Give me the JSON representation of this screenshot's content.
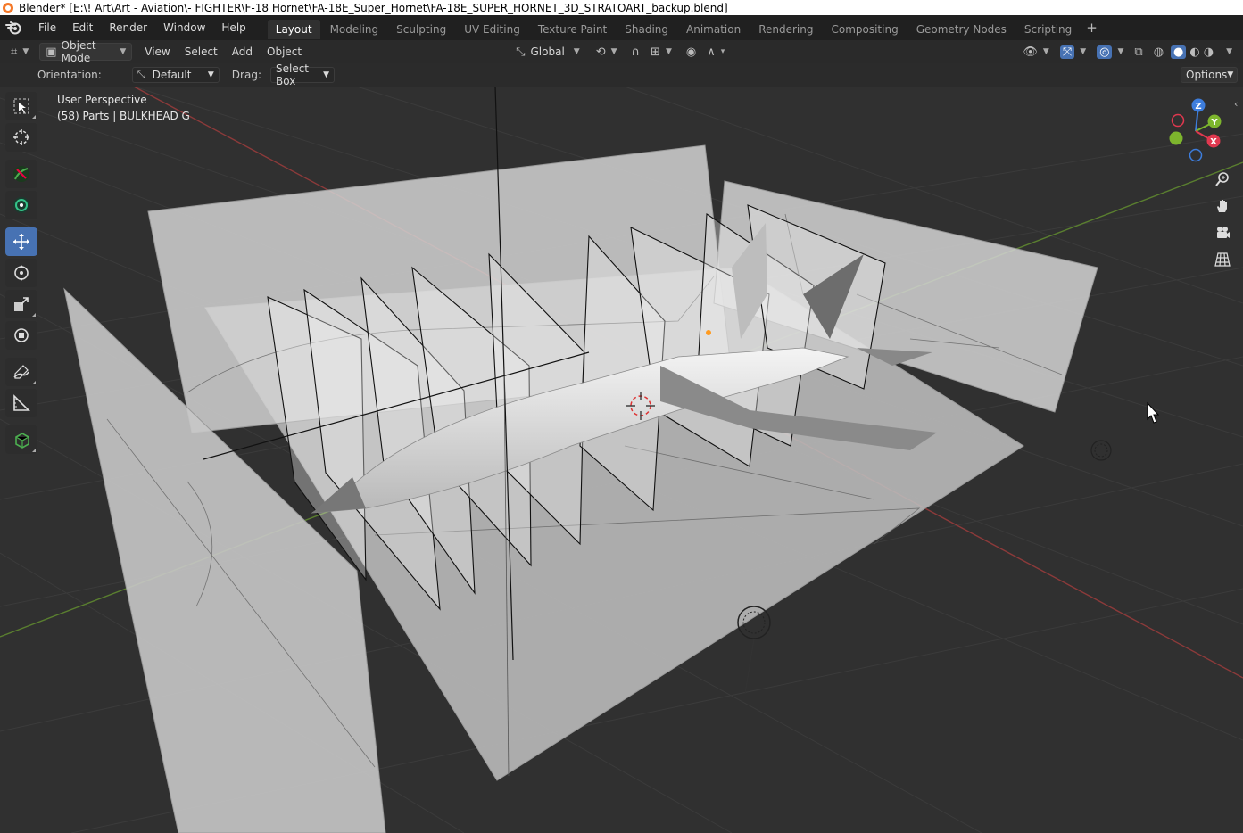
{
  "window": {
    "title": "Blender* [E:\\! Art\\Art - Aviation\\- FIGHTER\\F-18 Hornet\\FA-18E_Super_Hornet\\FA-18E_SUPER_HORNET_3D_STRATOART_backup.blend]"
  },
  "menu": {
    "items": [
      "File",
      "Edit",
      "Render",
      "Window",
      "Help"
    ]
  },
  "workspaces": {
    "tabs": [
      "Layout",
      "Modeling",
      "Sculpting",
      "UV Editing",
      "Texture Paint",
      "Shading",
      "Animation",
      "Rendering",
      "Compositing",
      "Geometry Nodes",
      "Scripting"
    ],
    "active": "Layout",
    "add_symbol": "+"
  },
  "header": {
    "mode": "Object Mode",
    "menus": [
      "View",
      "Select",
      "Add",
      "Object"
    ],
    "transform_orientation": "Global"
  },
  "tool_settings": {
    "orientation_label": "Orientation:",
    "orientation_value": "Default",
    "drag_label": "Drag:",
    "drag_value": "Select Box",
    "options_label": "Options"
  },
  "viewport": {
    "view_name": "User Perspective",
    "selection_info": "(58) Parts | BULKHEAD G"
  },
  "gizmo": {
    "z": "Z",
    "y": "Y",
    "x": "X",
    "colors": {
      "x": "#e0384f",
      "y": "#7db52d",
      "z": "#3d7ddc"
    }
  },
  "toolbar": {
    "tools": [
      "select-box",
      "cursor",
      "annotate-green",
      "move-view",
      "move",
      "rotate",
      "scale",
      "transform",
      "annotate",
      "measure",
      "add-cube"
    ],
    "active": "move"
  },
  "colors": {
    "accent": "#4772b3",
    "grid_bg": "#303030",
    "x_axis": "#c34a4a",
    "y_axis": "#6a9a3a"
  }
}
